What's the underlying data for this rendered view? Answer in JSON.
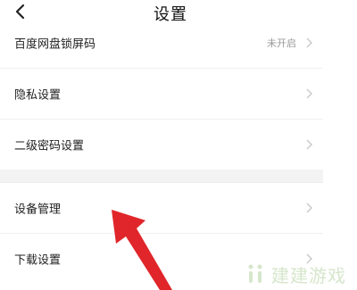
{
  "header": {
    "title": "设置",
    "back_icon": "chevron-left-icon"
  },
  "section1": {
    "items": [
      {
        "label": "百度网盘锁屏码",
        "value": "未开启"
      },
      {
        "label": "隐私设置"
      },
      {
        "label": "二级密码设置"
      }
    ]
  },
  "section2": {
    "items": [
      {
        "label": "设备管理"
      },
      {
        "label": "下载设置"
      }
    ]
  },
  "overlay": {
    "arrow_color": "#e0262a",
    "arrow_icon": "red-arrow-icon"
  },
  "watermark": {
    "text": "建建游戏"
  }
}
